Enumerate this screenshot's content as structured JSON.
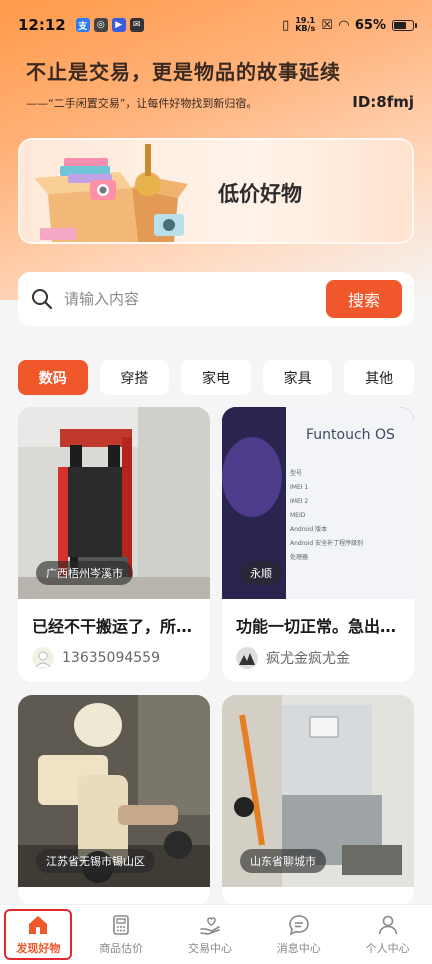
{
  "status_bar": {
    "time": "12:12",
    "net_speed_value": "19.1",
    "net_speed_unit": "KB/s",
    "battery": "65%"
  },
  "hero": {
    "headline": "不止是交易，更是物品的故事延续",
    "subline": "——“二手闲置交易”，让每件好物找到新归宿。",
    "user_id": "ID:8fmj"
  },
  "banner": {
    "title": "低价好物"
  },
  "search": {
    "placeholder": "请输入内容",
    "button_label": "搜索"
  },
  "tabs": [
    {
      "label": "数码",
      "active": true
    },
    {
      "label": "穿搭",
      "active": false
    },
    {
      "label": "家电",
      "active": false
    },
    {
      "label": "家具",
      "active": false
    },
    {
      "label": "其他",
      "active": false
    }
  ],
  "items": [
    {
      "location": "广西梧州岑溪市",
      "title": "已经不干搬运了，所以出售",
      "seller": "13635094559"
    },
    {
      "location": "永顺",
      "title": "功能一切正常。急出，懂的来",
      "seller": "疯尤金疯尤金"
    },
    {
      "location": "江苏省无锡市锡山区",
      "title": "",
      "seller": ""
    },
    {
      "location": "山东省聊城市",
      "title": "",
      "seller": ""
    }
  ],
  "phone_screen": {
    "os_name": "Funtouch OS",
    "rows": [
      "型号",
      "IMEI 1",
      "IMEI 2",
      "MEID",
      "Android 版本",
      "Android 安全补丁程序级别",
      "处理器"
    ]
  },
  "bottom_nav": [
    {
      "label": "发现好物",
      "icon": "home-icon",
      "active": true
    },
    {
      "label": "商品估价",
      "icon": "calculator-icon",
      "active": false
    },
    {
      "label": "交易中心",
      "icon": "hand-heart-icon",
      "active": false
    },
    {
      "label": "消息中心",
      "icon": "chat-icon",
      "active": false
    },
    {
      "label": "个人中心",
      "icon": "user-icon",
      "active": false
    }
  ],
  "colors": {
    "accent": "#f0572a",
    "hero_start": "#ff9a4a"
  }
}
